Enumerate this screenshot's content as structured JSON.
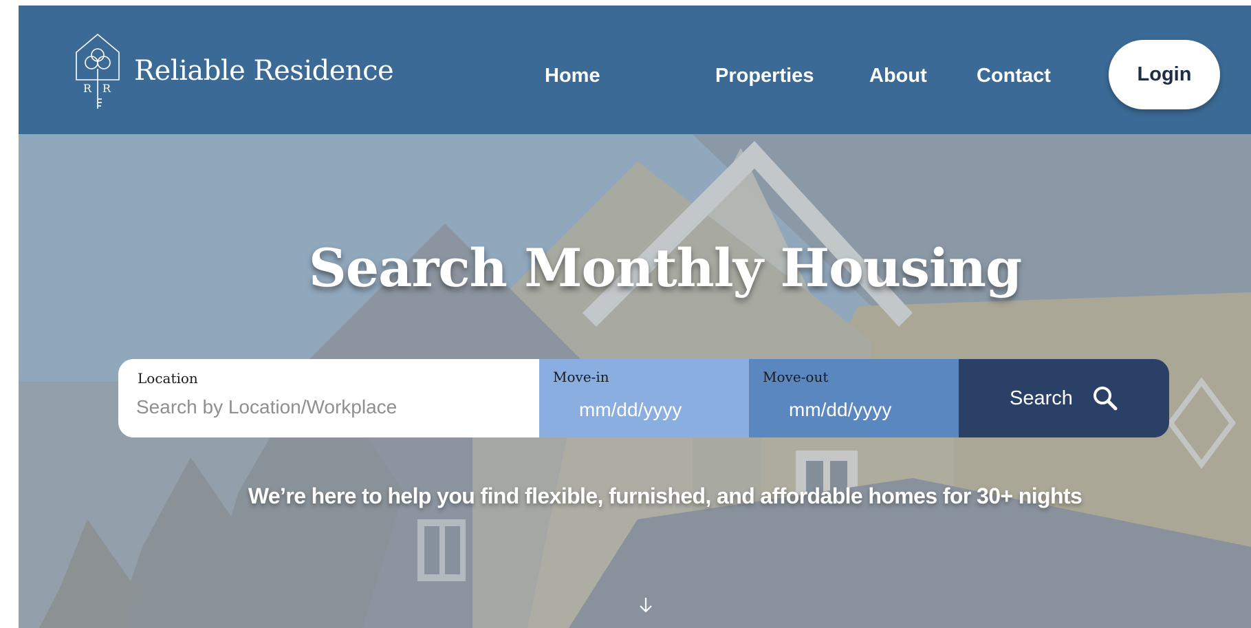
{
  "brand": {
    "name": "Reliable Residence",
    "monogram": "R R"
  },
  "nav": {
    "items": [
      {
        "label": "Home"
      },
      {
        "label": "Properties"
      },
      {
        "label": "About"
      },
      {
        "label": "Contact"
      }
    ],
    "login_label": "Login"
  },
  "hero": {
    "title": "Search Monthly Housing",
    "tagline": "We’re here to help you find flexible, furnished, and affordable homes for 30+ nights"
  },
  "search": {
    "location_label": "Location",
    "location_placeholder": "Search by Location/Workplace",
    "movein_label": "Move-in",
    "movein_placeholder": "mm/dd/yyyy",
    "moveout_label": "Move-out",
    "moveout_placeholder": "mm/dd/yyyy",
    "button_label": "Search"
  },
  "colors": {
    "header": "#3b6a96",
    "movein_bg": "#8aaee0",
    "moveout_bg": "#5a87c0",
    "search_bg": "#2a4067"
  },
  "icons": {
    "logo": "house-clover-key-icon",
    "search": "search-icon",
    "scroll": "arrow-down-icon"
  }
}
